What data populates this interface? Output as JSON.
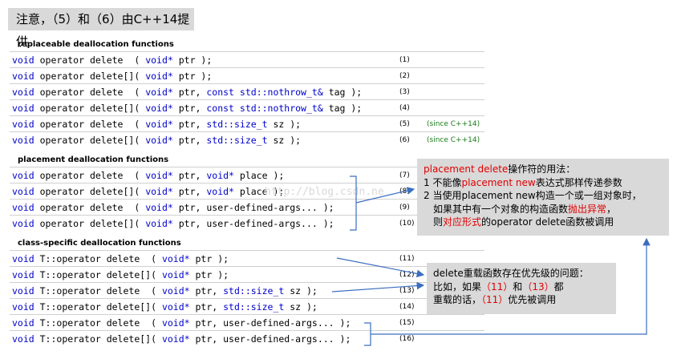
{
  "title": "注意，（5）和（6）由C++14提供",
  "sections": [
    {
      "label": "replaceable deallocation functions"
    },
    {
      "label": "placement deallocation functions"
    },
    {
      "label": "class-specific deallocation functions"
    }
  ],
  "rows": [
    {
      "parts": [
        [
          "void",
          "kw"
        ],
        [
          " operator delete  ( ",
          ""
        ],
        [
          "void*",
          "kw"
        ],
        [
          " ptr );",
          ""
        ]
      ],
      "num": "(1)",
      "since": ""
    },
    {
      "parts": [
        [
          "void",
          "kw"
        ],
        [
          " operator delete[]( ",
          ""
        ],
        [
          "void*",
          "kw"
        ],
        [
          " ptr );",
          ""
        ]
      ],
      "num": "(2)",
      "since": ""
    },
    {
      "parts": [
        [
          "void",
          "kw"
        ],
        [
          " operator delete  ( ",
          ""
        ],
        [
          "void*",
          "kw"
        ],
        [
          " ptr, ",
          ""
        ],
        [
          "const std::nothrow_t&",
          "kw"
        ],
        [
          " tag );",
          ""
        ]
      ],
      "num": "(3)",
      "since": ""
    },
    {
      "parts": [
        [
          "void",
          "kw"
        ],
        [
          " operator delete[]( ",
          ""
        ],
        [
          "void*",
          "kw"
        ],
        [
          " ptr, ",
          ""
        ],
        [
          "const std::nothrow_t&",
          "kw"
        ],
        [
          " tag );",
          ""
        ]
      ],
      "num": "(4)",
      "since": ""
    },
    {
      "parts": [
        [
          "void",
          "kw"
        ],
        [
          " operator delete  ( ",
          ""
        ],
        [
          "void*",
          "kw"
        ],
        [
          " ptr, ",
          ""
        ],
        [
          "std::size_t",
          "kw"
        ],
        [
          " sz );",
          ""
        ]
      ],
      "num": "(5)",
      "since": "(since C++14)"
    },
    {
      "parts": [
        [
          "void",
          "kw"
        ],
        [
          " operator delete[]( ",
          ""
        ],
        [
          "void*",
          "kw"
        ],
        [
          " ptr, ",
          ""
        ],
        [
          "std::size_t",
          "kw"
        ],
        [
          " sz );",
          ""
        ]
      ],
      "num": "(6)",
      "since": "(since C++14)"
    },
    {
      "parts": [
        [
          "void",
          "kw"
        ],
        [
          " operator delete  ( ",
          ""
        ],
        [
          "void*",
          "kw"
        ],
        [
          " ptr, ",
          ""
        ],
        [
          "void*",
          "kw"
        ],
        [
          " place );",
          ""
        ]
      ],
      "num": "(7)",
      "since": ""
    },
    {
      "parts": [
        [
          "void",
          "kw"
        ],
        [
          " operator delete[]( ",
          ""
        ],
        [
          "void*",
          "kw"
        ],
        [
          " ptr, ",
          ""
        ],
        [
          "void*",
          "kw"
        ],
        [
          " place );",
          ""
        ]
      ],
      "num": "(8)",
      "since": ""
    },
    {
      "parts": [
        [
          "void",
          "kw"
        ],
        [
          " operator delete  ( ",
          ""
        ],
        [
          "void*",
          "kw"
        ],
        [
          " ptr, user-defined-args... );",
          ""
        ]
      ],
      "num": "(9)",
      "since": ""
    },
    {
      "parts": [
        [
          "void",
          "kw"
        ],
        [
          " operator delete[]( ",
          ""
        ],
        [
          "void*",
          "kw"
        ],
        [
          " ptr, user-defined-args... );",
          ""
        ]
      ],
      "num": "(10)",
      "since": ""
    },
    {
      "parts": [
        [
          "void",
          "kw"
        ],
        [
          " T::operator delete  ( ",
          ""
        ],
        [
          "void*",
          "kw"
        ],
        [
          " ptr );",
          ""
        ]
      ],
      "num": "(11)",
      "since": ""
    },
    {
      "parts": [
        [
          "void",
          "kw"
        ],
        [
          " T::operator delete[]( ",
          ""
        ],
        [
          "void*",
          "kw"
        ],
        [
          " ptr );",
          ""
        ]
      ],
      "num": "(12)",
      "since": ""
    },
    {
      "parts": [
        [
          "void",
          "kw"
        ],
        [
          " T::operator delete  ( ",
          ""
        ],
        [
          "void*",
          "kw"
        ],
        [
          " ptr, ",
          ""
        ],
        [
          "std::size_t",
          "kw"
        ],
        [
          " sz );",
          ""
        ]
      ],
      "num": "(13)",
      "since": ""
    },
    {
      "parts": [
        [
          "void",
          "kw"
        ],
        [
          " T::operator delete[]( ",
          ""
        ],
        [
          "void*",
          "kw"
        ],
        [
          " ptr, ",
          ""
        ],
        [
          "std::size_t",
          "kw"
        ],
        [
          " sz );",
          ""
        ]
      ],
      "num": "(14)",
      "since": ""
    },
    {
      "parts": [
        [
          "void",
          "kw"
        ],
        [
          " T::operator delete  ( ",
          ""
        ],
        [
          "void*",
          "kw"
        ],
        [
          " ptr, user-defined-args... );",
          ""
        ]
      ],
      "num": "(15)",
      "since": ""
    },
    {
      "parts": [
        [
          "void",
          "kw"
        ],
        [
          " T::operator delete[]( ",
          ""
        ],
        [
          "void*",
          "kw"
        ],
        [
          " ptr, user-defined-args... );",
          ""
        ]
      ],
      "num": "(16)",
      "since": ""
    }
  ],
  "note1": {
    "line1": [
      [
        "placement delete",
        "red"
      ],
      [
        "操作符的用法：",
        ""
      ]
    ],
    "line2": [
      [
        "1 不能像",
        ""
      ],
      [
        "placement new",
        "red"
      ],
      [
        "表达式那样传递参数",
        ""
      ]
    ],
    "line3": [
      [
        "2 当使用placement new构造一个或一组对象时，",
        ""
      ]
    ],
    "line4": [
      [
        "如果其中有一个对象的构造函数",
        ""
      ],
      [
        "抛出异常",
        "red"
      ],
      [
        "，",
        ""
      ]
    ],
    "line5": [
      [
        "则",
        ""
      ],
      [
        "对应形式",
        "red"
      ],
      [
        "的operator delete函数被调用",
        ""
      ]
    ]
  },
  "note2": {
    "line1": [
      [
        "delete重载函数存在优先级的问题：",
        ""
      ]
    ],
    "line2": [
      [
        "比如，如果",
        ""
      ],
      [
        "（11）",
        "red"
      ],
      [
        "和",
        ""
      ],
      [
        "（13）",
        "red"
      ],
      [
        "都",
        ""
      ]
    ],
    "line3": [
      [
        "重载的话，",
        ""
      ],
      [
        "（11）",
        "red"
      ],
      [
        "优先被调用",
        ""
      ]
    ]
  },
  "watermark": "http://blog.csdn.ne",
  "colors": {
    "keyword": "#0000cc",
    "highlight": "#e00000",
    "since": "#1a7a1a",
    "arrow": "#3a6ec0",
    "box": "#d9d9d9"
  }
}
